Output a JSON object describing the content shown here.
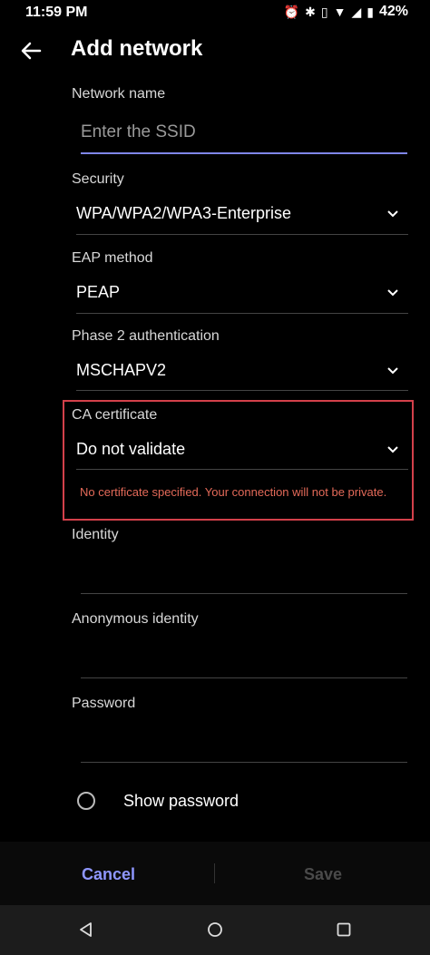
{
  "status_bar": {
    "time": "11:59 PM",
    "battery": "42%"
  },
  "header": {
    "title": "Add network"
  },
  "form": {
    "network_name": {
      "label": "Network name",
      "placeholder": "Enter the SSID"
    },
    "security": {
      "label": "Security",
      "value": "WPA/WPA2/WPA3-Enterprise"
    },
    "eap_method": {
      "label": "EAP method",
      "value": "PEAP"
    },
    "phase2": {
      "label": "Phase 2 authentication",
      "value": "MSCHAPV2"
    },
    "ca_certificate": {
      "label": "CA certificate",
      "value": "Do not validate",
      "warning": "No certificate specified. Your connection will not be private."
    },
    "identity": {
      "label": "Identity"
    },
    "anonymous_identity": {
      "label": "Anonymous identity"
    },
    "password": {
      "label": "Password"
    },
    "show_password": {
      "label": "Show password"
    }
  },
  "actions": {
    "cancel": "Cancel",
    "save": "Save"
  },
  "colors": {
    "accent": "#8f97ff",
    "warning": "#e46a59",
    "highlight_border": "#d3404a"
  }
}
